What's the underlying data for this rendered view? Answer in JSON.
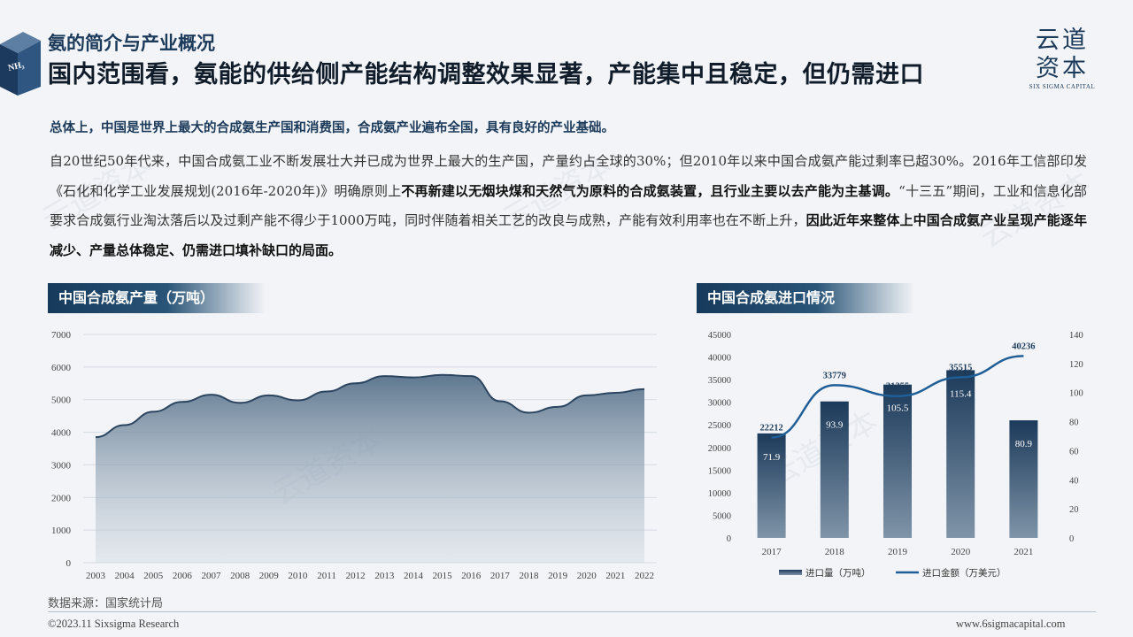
{
  "header": {
    "subtitle": "氨的简介与产业概况",
    "title": "国内范围看，氨能的供给侧产能结构调整效果显著，产能集中且稳定，但仍需进口",
    "cube_label": "NH₃"
  },
  "logo": {
    "cn_line1": "云道",
    "cn_line2": "资本",
    "en": "SIX SIGMA CAPITAL"
  },
  "body": {
    "lead": "总体上，中国是世界上最大的合成氨生产国和消费国，合成氨产业遍布全国，具有良好的产业基础。",
    "p1": "自20世纪50年代来，中国合成氨工业不断发展壮大并已成为世界上最大的生产国，产量约占全球的30%；但2010年以来中国合成氨产能过剩率已超30%。2016年工信部印发《石化和化学工业发展规划(2016年-2020年)》明确原则上",
    "p1_bold": "不再新建以无烟块煤和天然气为原料的合成氨装置，且行业主要以去产能为主基调。",
    "p2": "“十三五”期间，工业和信息化部要求合成氨行业淘汰落后以及过剩产能不得少于1000万吨，同时伴随着相关工艺的改良与成熟，产能有效利用率也在不断上升，",
    "p2_bold": "因此近年来整体上中国合成氨产业呈现产能逐年减少、产量总体稳定、仍需进口填补缺口的局面。"
  },
  "sections": {
    "chart1_title": "中国合成氨产量（万吨）",
    "chart2_title": "中国合成氨进口情况"
  },
  "footer": {
    "source": "数据来源：国家统计局",
    "copyright": "©2023.11 Sixsigma Research",
    "url": "www.6sigmacapital.com"
  },
  "colors": {
    "navy": "#1c3a5a",
    "accent_line": "#1f5e96",
    "area_top": "#5f7890"
  },
  "chart_data": [
    {
      "type": "area",
      "x": [
        "2003",
        "2004",
        "2005",
        "2006",
        "2007",
        "2008",
        "2009",
        "2010",
        "2011",
        "2012",
        "2013",
        "2014",
        "2015",
        "2016",
        "2017",
        "2018",
        "2019",
        "2020",
        "2021",
        "2022"
      ],
      "values": [
        3850,
        4220,
        4630,
        4930,
        5150,
        4900,
        5130,
        4980,
        5250,
        5500,
        5720,
        5680,
        5760,
        5720,
        4950,
        4600,
        4780,
        5130,
        5210,
        5320
      ],
      "ylim": [
        0,
        7000
      ],
      "yticks": [
        0,
        1000,
        2000,
        3000,
        4000,
        5000,
        6000,
        7000
      ],
      "grid": true
    },
    {
      "type": "bar",
      "categories": [
        "2017",
        "2018",
        "2019",
        "2020",
        "2021"
      ],
      "series": [
        {
          "name": "进口量（万吨）",
          "type": "bar",
          "axis": "left",
          "values": [
            71.9,
            93.9,
            105.5,
            115.4,
            80.9
          ]
        },
        {
          "name": "进口金额（万美元）",
          "type": "line",
          "axis": "right",
          "values": [
            22212,
            33779,
            31355,
            35515,
            40236
          ]
        }
      ],
      "ylim_left": [
        0,
        45000
      ],
      "yticks_left": [
        0,
        5000,
        10000,
        15000,
        20000,
        25000,
        30000,
        35000,
        40000,
        45000
      ],
      "ylim_right": [
        0,
        140
      ],
      "yticks_right": [
        0,
        20,
        40,
        60,
        80,
        100,
        120,
        140
      ],
      "legend": "bottom"
    }
  ]
}
